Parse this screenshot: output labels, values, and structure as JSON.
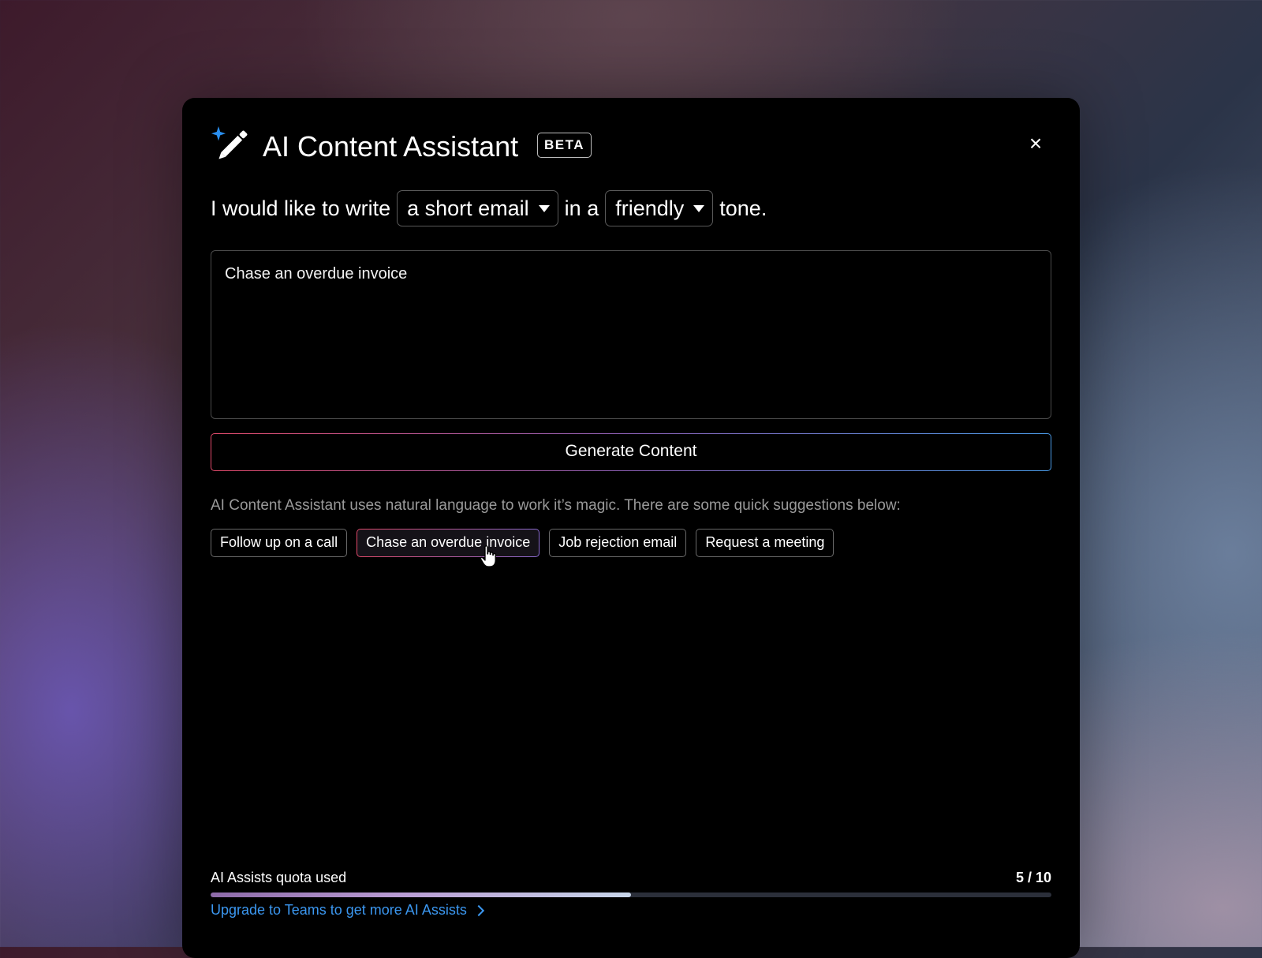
{
  "header": {
    "title": "AI Content Assistant",
    "badge": "BETA",
    "icon": "magic-wand-icon",
    "close_icon": "×"
  },
  "prompt_builder": {
    "prefix": "I would like to write",
    "content_type": "a short email",
    "connector": "in a",
    "tone": "friendly",
    "suffix": "tone."
  },
  "input": {
    "value": "Chase an overdue invoice"
  },
  "generate_label": "Generate Content",
  "hint": "AI Content Assistant uses natural language to work it’s magic. There are some quick suggestions below:",
  "suggestions": [
    {
      "label": "Follow up on a call"
    },
    {
      "label": "Chase an overdue invoice"
    },
    {
      "label": "Job rejection email"
    },
    {
      "label": "Request a meeting"
    }
  ],
  "active_suggestion": 1,
  "quota": {
    "label": "AI Assists quota used",
    "count_text": "5 / 10",
    "used": 5,
    "total": 10
  },
  "upgrade_label": "Upgrade to Teams to get more AI Assists",
  "colors": {
    "accent_blue": "#3b97f0",
    "accent_pink": "#e24a6b",
    "sparkle": "#2a8ff0"
  }
}
